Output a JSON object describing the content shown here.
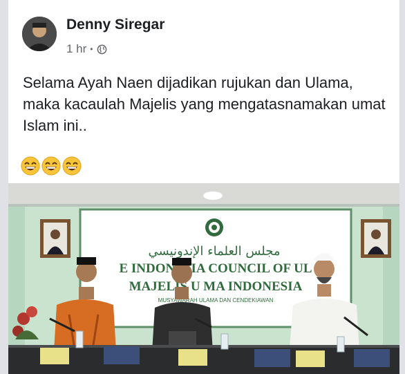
{
  "post": {
    "author": "Denny Siregar",
    "time": "1 hr",
    "separator": "•",
    "text": "Selama Ayah Naen dijadikan rujukan dan Ulama, maka kacaulah Majelis yang mengatasnamakan umat Islam ini..",
    "emojis": [
      "grinning-face",
      "grinning-face",
      "grinning-face"
    ]
  },
  "photo": {
    "banner_arabic": "مجلس العلماء الإندونيسي",
    "banner_line1": "E INDONESIA   COUNCIL OF UL",
    "banner_line2": "MAJELIS U   MA INDONESIA",
    "banner_line3": "MUSYAWARAH  ULAMA  DAN CENDEKIAWAN"
  },
  "colors": {
    "author": "#1c1e21",
    "meta": "#65676b",
    "wall": "#c9e3cf",
    "banner_green": "#2f6b3c"
  }
}
